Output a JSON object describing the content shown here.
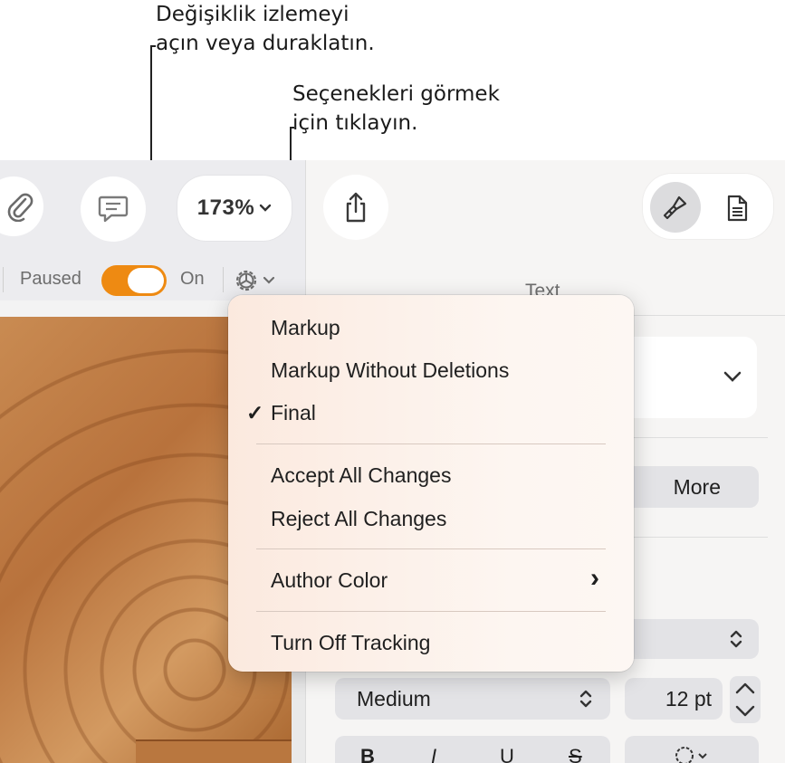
{
  "callouts": {
    "toggle_line1": "Değişiklik izlemeyi",
    "toggle_line2": "açın veya duraklatın.",
    "options_line1": "Seçenekleri görmek",
    "options_line2": "için tıklayın."
  },
  "toolbar": {
    "zoom_label": "173%"
  },
  "tracking": {
    "paused_label": "Paused",
    "on_label": "On",
    "state_on": true,
    "accent_color": "#ee8a12"
  },
  "inspector": {
    "section_title": "Text",
    "more_button": "More",
    "weight_value": "Medium",
    "size_value": "12 pt",
    "style_bold": "B",
    "style_italic": "I",
    "style_underline": "U",
    "style_strike": "S"
  },
  "menu": {
    "items": [
      {
        "label": "Markup",
        "checked": false
      },
      {
        "label": "Markup Without Deletions",
        "checked": false
      },
      {
        "label": "Final",
        "checked": true
      },
      {
        "label": "Accept All Changes"
      },
      {
        "label": "Reject All Changes"
      },
      {
        "label": "Author Color",
        "submenu": true
      },
      {
        "label": "Turn Off Tracking"
      }
    ],
    "check_glyph": "✓",
    "submenu_glyph": "›"
  },
  "icons": [
    "paperclip-icon",
    "comment-icon",
    "chevron-down-icon",
    "share-icon",
    "format-brush-icon",
    "document-icon",
    "gear-icon",
    "checkmark-icon",
    "chevron-right-icon",
    "stepper-icon"
  ]
}
